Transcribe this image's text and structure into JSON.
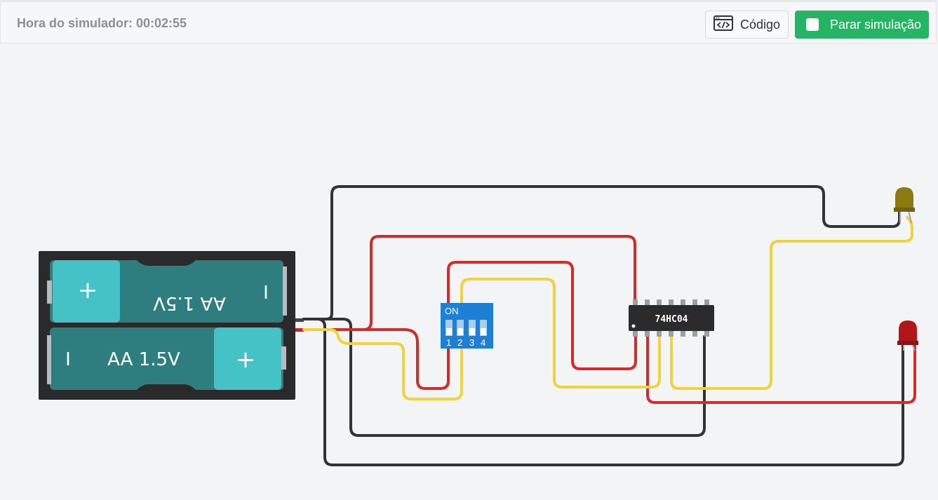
{
  "toolbar": {
    "sim_time": "Hora do simulador: 00:02:55",
    "code_label": "Código",
    "code_icon": "code-window-icon",
    "stop_label": "Parar simulação",
    "stop_icon": "stop-square-icon",
    "accent_color": "#24b463"
  },
  "circuit": {
    "battery": {
      "cell_top_label": "AA 1.5V",
      "cell_bottom_label": "AA 1.5V",
      "plus": "+",
      "minus": "I"
    },
    "dip_switch": {
      "on_label": "ON",
      "numbers": [
        "1",
        "2",
        "3",
        "4"
      ]
    },
    "ic_label": "74HC04",
    "led_colors": {
      "yellow": "#8a7a10",
      "red": "#b3161a"
    },
    "wire_colors": {
      "black": "#333333",
      "red": "#d42a2a",
      "yellow": "#f2d23c"
    }
  }
}
